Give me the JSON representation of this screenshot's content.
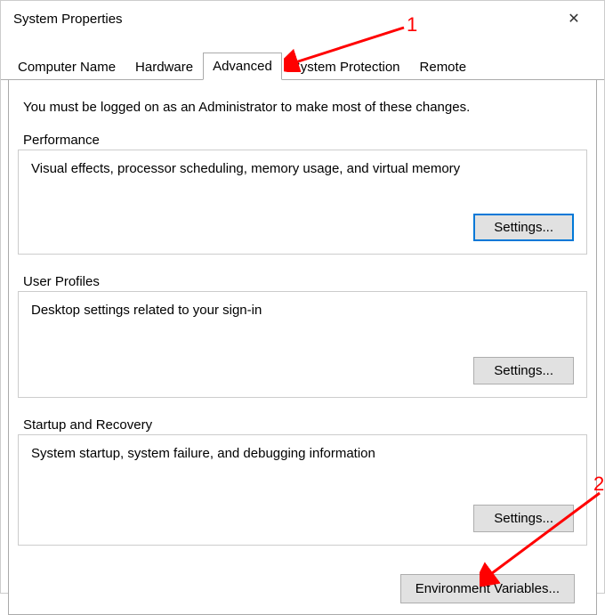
{
  "window": {
    "title": "System Properties"
  },
  "tabs": {
    "items": [
      {
        "label": "Computer Name"
      },
      {
        "label": "Hardware"
      },
      {
        "label": "Advanced"
      },
      {
        "label": "System Protection"
      },
      {
        "label": "Remote"
      }
    ],
    "activeIndex": 2
  },
  "content": {
    "adminNotice": "You must be logged on as an Administrator to make most of these changes.",
    "groups": {
      "performance": {
        "label": "Performance",
        "desc": "Visual effects, processor scheduling, memory usage, and virtual memory",
        "button": "Settings..."
      },
      "userProfiles": {
        "label": "User Profiles",
        "desc": "Desktop settings related to your sign-in",
        "button": "Settings..."
      },
      "startup": {
        "label": "Startup and Recovery",
        "desc": "System startup, system failure, and debugging information",
        "button": "Settings..."
      }
    },
    "envButton": "Environment Variables..."
  },
  "annotations": {
    "one": "1",
    "two": "2"
  }
}
